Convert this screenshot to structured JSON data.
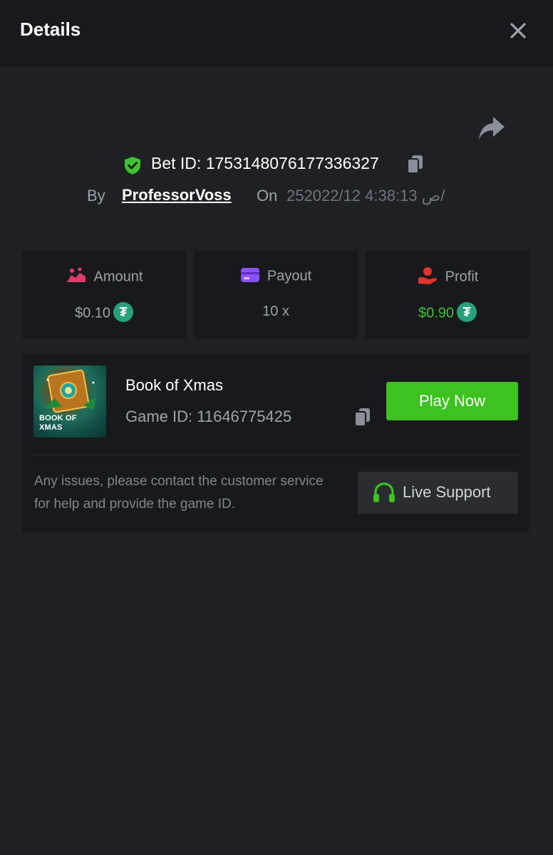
{
  "header": {
    "title": "Details"
  },
  "bet": {
    "id_text": "Bet ID: 1753148076177336327",
    "by_label": "By",
    "username": "ProfessorVoss",
    "on_label": "On",
    "date": "25ص 4:38:13 2022/12/"
  },
  "stats": {
    "amount": {
      "label": "Amount",
      "value": "$0.10",
      "icon": "coins-hand-icon",
      "color": "#e23b6a"
    },
    "payout": {
      "label": "Payout",
      "value": "10 x",
      "icon": "card-icon",
      "color": "#8c52ff"
    },
    "profit": {
      "label": "Profit",
      "value": "$0.90",
      "icon": "profit-hand-icon",
      "color": "#e0342c",
      "value_color": "#3dc230"
    }
  },
  "coin_symbol": "₮",
  "game": {
    "thumb_text": "BOOK OF XMAS",
    "name": "Book of Xmas",
    "id_text": "Game ID: 11646775425",
    "play_label": "Play Now",
    "help_text": "Any issues, please contact the customer service for help and provide the game ID.",
    "support_label": "Live Support"
  },
  "colors": {
    "accent_green": "#3dc21f",
    "background": "#1f2023",
    "panel": "#18191c"
  }
}
